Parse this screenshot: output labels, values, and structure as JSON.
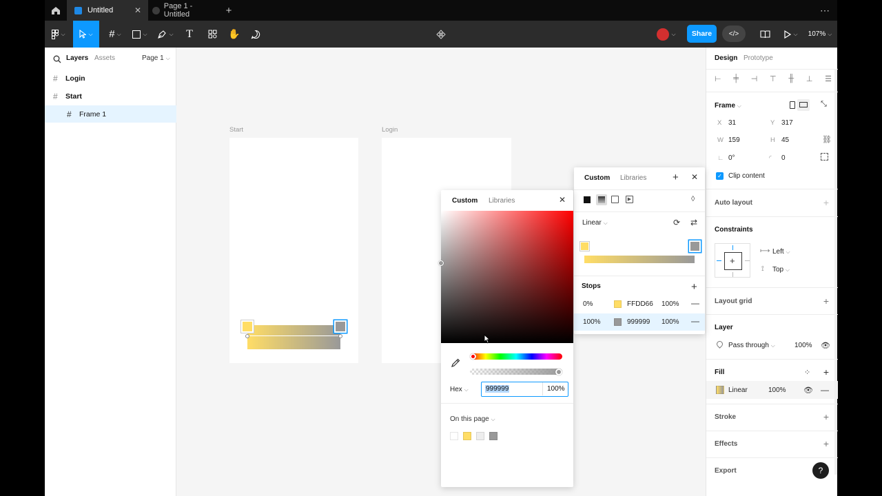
{
  "tabs": [
    {
      "label": "Untitled"
    },
    {
      "label": "Page 1 - Untitled"
    }
  ],
  "toolbar": {
    "share_label": "Share",
    "zoom": "107%"
  },
  "left_panel": {
    "tab_layers": "Layers",
    "tab_assets": "Assets",
    "page_select": "Page 1",
    "layers": [
      {
        "name": "Login"
      },
      {
        "name": "Start"
      },
      {
        "name": "Frame 1"
      }
    ]
  },
  "canvas": {
    "frames": [
      {
        "label": "Start"
      },
      {
        "label": "Login"
      }
    ]
  },
  "color_picker": {
    "tab_custom": "Custom",
    "tab_libraries": "Libraries",
    "format": "Hex",
    "hex_value": "999999",
    "opacity": "100%",
    "on_this_page": "On this page",
    "page_colors": [
      "#ffffff",
      "#ffdd66",
      "#eeeeee",
      "#999999"
    ],
    "hue_color": "#ff0000"
  },
  "fill_popup": {
    "tab_custom": "Custom",
    "tab_libraries": "Libraries",
    "gradient_type": "Linear",
    "stops_title": "Stops",
    "stops": [
      {
        "position": "0%",
        "hex": "FFDD66",
        "opacity": "100%",
        "color": "#ffdd66"
      },
      {
        "position": "100%",
        "hex": "999999",
        "opacity": "100%",
        "color": "#999999"
      }
    ]
  },
  "right_panel": {
    "tab_design": "Design",
    "tab_prototype": "Prototype",
    "frame_title": "Frame",
    "x_label": "X",
    "x_value": "31",
    "y_label": "Y",
    "y_value": "317",
    "w_label": "W",
    "w_value": "159",
    "h_label": "H",
    "h_value": "45",
    "rotation": "0°",
    "radius": "0",
    "clip_content": "Clip content",
    "auto_layout": "Auto layout",
    "constraints": "Constraints",
    "constraint_h": "Left",
    "constraint_v": "Top",
    "layout_grid": "Layout grid",
    "layer_title": "Layer",
    "blend_mode": "Pass through",
    "layer_opacity": "100%",
    "fill_title": "Fill",
    "fill_type": "Linear",
    "fill_opacity": "100%",
    "stroke": "Stroke",
    "effects": "Effects",
    "export": "Export"
  },
  "colors": {
    "accent": "#0d99ff",
    "stop_yellow": "#ffdd66",
    "stop_gray": "#999999"
  }
}
